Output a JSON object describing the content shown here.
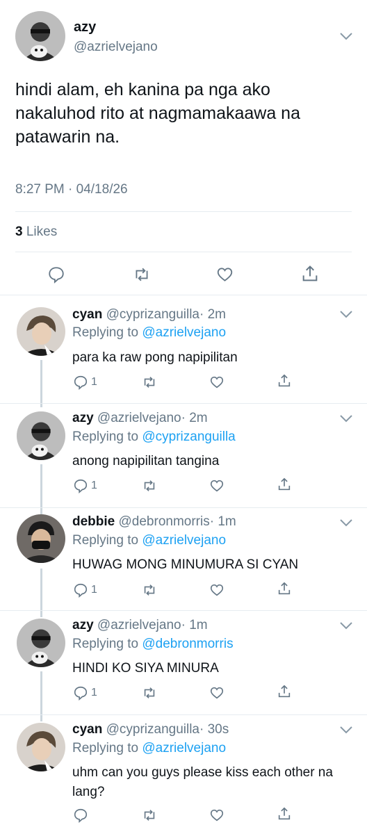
{
  "main_tweet": {
    "display_name": "azy",
    "handle": "@azrielvejano",
    "text": "hindi alam, eh kanina pa nga ako nakaluhod rito at nagmamakaawa na patawarin na.",
    "timestamp": "8:27 PM · 04/18/26",
    "likes_count": "3",
    "likes_label": "Likes"
  },
  "reply_prefix": "Replying to",
  "replies": [
    {
      "display_name": "cyan",
      "handle": "@cyprizanguilla",
      "time": "· 2m",
      "replying_to": "@azrielvejano",
      "text": "para ka raw pong napipilitan",
      "reply_count": "1"
    },
    {
      "display_name": "azy",
      "handle": "@azrielvejano",
      "time": "· 2m",
      "replying_to": "@cyprizanguilla",
      "text": "anong napipilitan tangina",
      "reply_count": "1"
    },
    {
      "display_name": "debbie",
      "handle": "@debronmorris",
      "time": "· 1m",
      "replying_to": "@azrielvejano",
      "text": "HUWAG MONG MINUMURA SI CYAN",
      "reply_count": "1"
    },
    {
      "display_name": "azy",
      "handle": "@azrielvejano",
      "time": "· 1m",
      "replying_to": "@debronmorris",
      "text": "HINDI KO SIYA MINURA",
      "reply_count": "1"
    },
    {
      "display_name": "cyan",
      "handle": "@cyprizanguilla",
      "time": "· 30s",
      "replying_to": "@azrielvejano",
      "text": "uhm can you guys please kiss each other na lang?",
      "reply_count": ""
    }
  ]
}
